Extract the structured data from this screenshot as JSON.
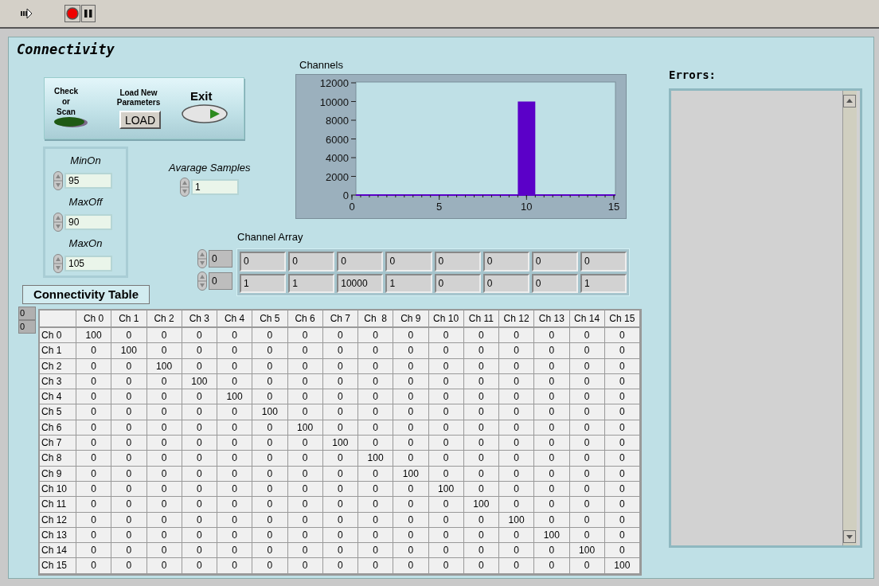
{
  "panel_title": "Connectivity",
  "check_scan": {
    "label": "Check or Scan",
    "on": false
  },
  "load": {
    "label": "Load New Parameters",
    "button": "LOAD"
  },
  "exit": {
    "label": "Exit"
  },
  "limits": [
    {
      "label": "MinOn",
      "value": "95"
    },
    {
      "label": "MaxOff",
      "value": "90"
    },
    {
      "label": "MaxOn",
      "value": "105"
    }
  ],
  "average_samples": {
    "label": "Avarage Samples",
    "value": "1"
  },
  "chart": {
    "label": "Channels",
    "chart_data": {
      "type": "bar",
      "x": [
        0,
        1,
        2,
        3,
        4,
        5,
        6,
        7,
        8,
        9,
        10,
        11,
        12,
        13,
        14,
        15
      ],
      "series": [
        {
          "color": "#5b00c8",
          "values": [
            0,
            0,
            0,
            0,
            0,
            0,
            0,
            0,
            0,
            0,
            10000,
            0,
            0,
            0,
            0,
            0
          ]
        }
      ],
      "xlim": [
        0,
        15
      ],
      "ylim": [
        0,
        12000
      ],
      "xticks": [
        0,
        5,
        10,
        15
      ],
      "yticks": [
        0,
        2000,
        4000,
        6000,
        8000,
        10000,
        12000
      ]
    }
  },
  "channel_array": {
    "label": "Channel Array",
    "indices": [
      "0",
      "0"
    ],
    "rows": [
      [
        "0",
        "0",
        "0",
        "0",
        "0",
        "0",
        "0",
        "0"
      ],
      [
        "1",
        "1",
        "10000",
        "1",
        "0",
        "0",
        "0",
        "1"
      ]
    ]
  },
  "table": {
    "label": "Connectivity Table",
    "indices": [
      "0",
      "0"
    ],
    "columns": [
      "Ch 0",
      "Ch 1",
      "Ch 2",
      "Ch 3",
      "Ch 4",
      "Ch 5",
      "Ch 6",
      "Ch 7",
      "Ch  8",
      "Ch 9",
      "Ch 10",
      "Ch 11",
      "Ch 12",
      "Ch 13",
      "Ch 14",
      "Ch 15"
    ],
    "rows": [
      {
        "label": "Ch 0",
        "cells": [
          "100",
          "0",
          "0",
          "0",
          "0",
          "0",
          "0",
          "0",
          "0",
          "0",
          "0",
          "0",
          "0",
          "0",
          "0",
          "0"
        ]
      },
      {
        "label": "Ch 1",
        "cells": [
          "0",
          "100",
          "0",
          "0",
          "0",
          "0",
          "0",
          "0",
          "0",
          "0",
          "0",
          "0",
          "0",
          "0",
          "0",
          "0"
        ]
      },
      {
        "label": "Ch 2",
        "cells": [
          "0",
          "0",
          "100",
          "0",
          "0",
          "0",
          "0",
          "0",
          "0",
          "0",
          "0",
          "0",
          "0",
          "0",
          "0",
          "0"
        ]
      },
      {
        "label": "Ch 3",
        "cells": [
          "0",
          "0",
          "0",
          "100",
          "0",
          "0",
          "0",
          "0",
          "0",
          "0",
          "0",
          "0",
          "0",
          "0",
          "0",
          "0"
        ]
      },
      {
        "label": "Ch 4",
        "cells": [
          "0",
          "0",
          "0",
          "0",
          "100",
          "0",
          "0",
          "0",
          "0",
          "0",
          "0",
          "0",
          "0",
          "0",
          "0",
          "0"
        ]
      },
      {
        "label": "Ch 5",
        "cells": [
          "0",
          "0",
          "0",
          "0",
          "0",
          "100",
          "0",
          "0",
          "0",
          "0",
          "0",
          "0",
          "0",
          "0",
          "0",
          "0"
        ]
      },
      {
        "label": "Ch 6",
        "cells": [
          "0",
          "0",
          "0",
          "0",
          "0",
          "0",
          "100",
          "0",
          "0",
          "0",
          "0",
          "0",
          "0",
          "0",
          "0",
          "0"
        ]
      },
      {
        "label": "Ch 7",
        "cells": [
          "0",
          "0",
          "0",
          "0",
          "0",
          "0",
          "0",
          "100",
          "0",
          "0",
          "0",
          "0",
          "0",
          "0",
          "0",
          "0"
        ]
      },
      {
        "label": "Ch 8",
        "cells": [
          "0",
          "0",
          "0",
          "0",
          "0",
          "0",
          "0",
          "0",
          "100",
          "0",
          "0",
          "0",
          "0",
          "0",
          "0",
          "0"
        ]
      },
      {
        "label": "Ch 9",
        "cells": [
          "0",
          "0",
          "0",
          "0",
          "0",
          "0",
          "0",
          "0",
          "0",
          "100",
          "0",
          "0",
          "0",
          "0",
          "0",
          "0"
        ]
      },
      {
        "label": "Ch 10",
        "cells": [
          "0",
          "0",
          "0",
          "0",
          "0",
          "0",
          "0",
          "0",
          "0",
          "0",
          "100",
          "0",
          "0",
          "0",
          "0",
          "0"
        ]
      },
      {
        "label": "Ch 11",
        "cells": [
          "0",
          "0",
          "0",
          "0",
          "0",
          "0",
          "0",
          "0",
          "0",
          "0",
          "0",
          "100",
          "0",
          "0",
          "0",
          "0"
        ]
      },
      {
        "label": "Ch 12",
        "cells": [
          "0",
          "0",
          "0",
          "0",
          "0",
          "0",
          "0",
          "0",
          "0",
          "0",
          "0",
          "0",
          "100",
          "0",
          "0",
          "0"
        ]
      },
      {
        "label": "Ch 13",
        "cells": [
          "0",
          "0",
          "0",
          "0",
          "0",
          "0",
          "0",
          "0",
          "0",
          "0",
          "0",
          "0",
          "0",
          "100",
          "0",
          "0"
        ]
      },
      {
        "label": "Ch 14",
        "cells": [
          "0",
          "0",
          "0",
          "0",
          "0",
          "0",
          "0",
          "0",
          "0",
          "0",
          "0",
          "0",
          "0",
          "0",
          "100",
          "0"
        ]
      },
      {
        "label": "Ch 15",
        "cells": [
          "0",
          "0",
          "0",
          "0",
          "0",
          "0",
          "0",
          "0",
          "0",
          "0",
          "0",
          "0",
          "0",
          "0",
          "0",
          "100"
        ]
      }
    ]
  },
  "errors": {
    "label": "Errors:"
  }
}
